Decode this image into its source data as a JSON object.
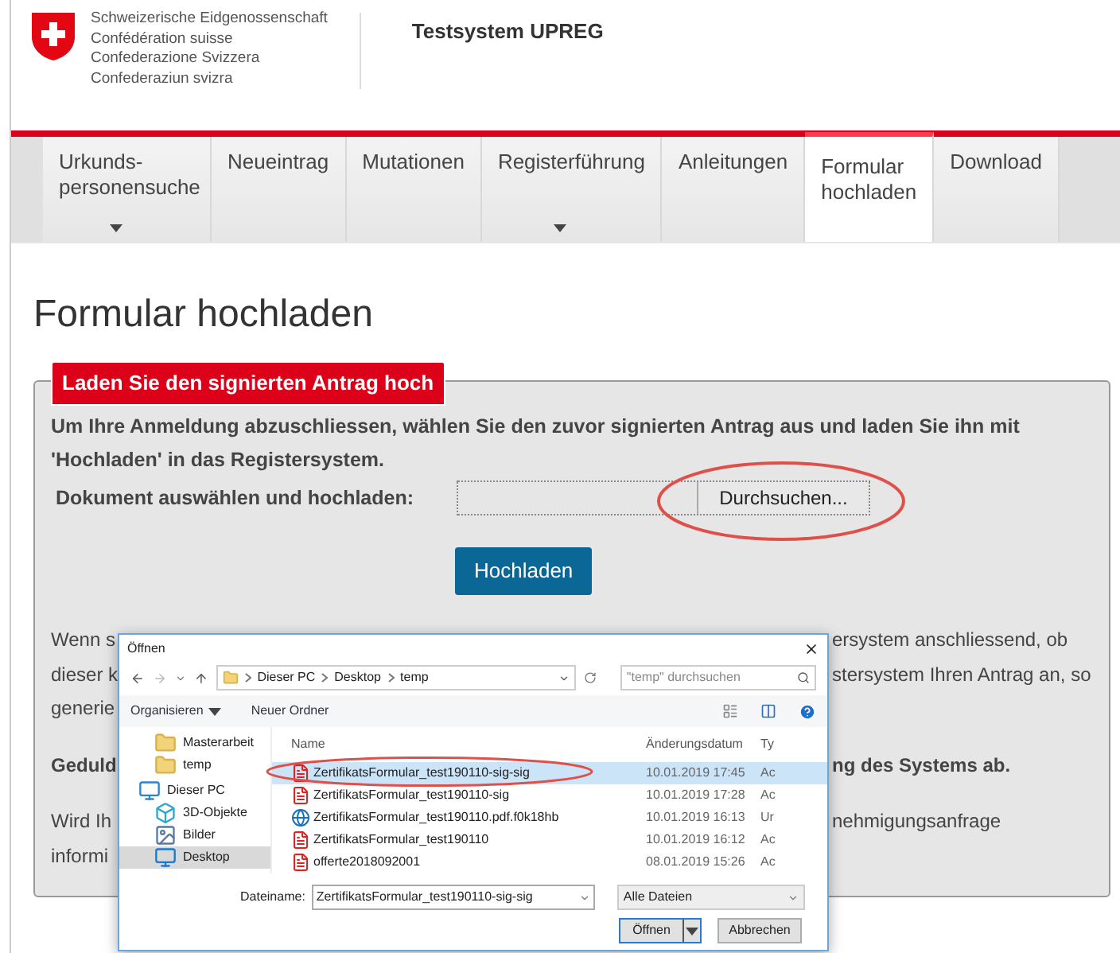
{
  "header": {
    "org_lines": [
      "Schweizerische Eidgenossenschaft",
      "Confédération suisse",
      "Confederazione Svizzera",
      "Confederaziun svizra"
    ],
    "title": "Testsystem UPREG"
  },
  "nav": [
    {
      "lines": [
        "Urkunds-",
        "personensuche"
      ],
      "dropdown": true,
      "selected": false
    },
    {
      "lines": [
        "Neueintrag"
      ],
      "dropdown": false,
      "selected": false
    },
    {
      "lines": [
        "Mutationen"
      ],
      "dropdown": false,
      "selected": false
    },
    {
      "lines": [
        "Registerführung"
      ],
      "dropdown": true,
      "selected": false
    },
    {
      "lines": [
        "Anleitungen"
      ],
      "dropdown": false,
      "selected": false
    },
    {
      "lines": [
        "Formular",
        "hochladen"
      ],
      "dropdown": false,
      "selected": true
    },
    {
      "lines": [
        "Download"
      ],
      "dropdown": false,
      "selected": false
    }
  ],
  "page_title": "Formular hochladen",
  "upload_panel": {
    "legend": "Laden Sie den signierten Antrag hoch",
    "intro": "Um Ihre Anmeldung abzuschliessen, wählen Sie den zuvor signierten Antrag aus und laden Sie ihn mit 'Hochladen' in das Registersystem.",
    "file_label": "Dokument auswählen und hochladen:",
    "browse_button": "Durchsuchen...",
    "upload_button": "Hochladen",
    "paragraphs": [
      {
        "bold": false,
        "lines": [
          {
            "left": "Wenn s",
            "right": "ersystem anschliessend, ob"
          },
          {
            "left": "dieser k",
            "right": "stersystem Ihren Antrag an, so"
          },
          {
            "left": "generie"
          }
        ]
      },
      {
        "bold": true,
        "lines": [
          {
            "left": "Geduld",
            "right": "ng des Systems ab."
          }
        ]
      },
      {
        "bold": false,
        "lines": [
          {
            "left": "Wird Ih",
            "right": "nehmigungsanfrage"
          },
          {
            "left": "informi"
          }
        ]
      }
    ]
  },
  "file_dialog": {
    "title": "Öffnen",
    "path": [
      "Dieser PC",
      "Desktop",
      "temp"
    ],
    "search": {
      "placeholder": "\"temp\" durchsuchen"
    },
    "toolbar": [
      "Organisieren",
      "Neuer Ordner"
    ],
    "nav_items": [
      {
        "label": "Masterarbeit",
        "kind": "folder",
        "selected": false
      },
      {
        "label": "temp",
        "kind": "folder",
        "selected": false
      },
      {
        "label": "Dieser PC",
        "kind": "pc",
        "selected": false
      },
      {
        "label": "3D-Objekte",
        "kind": "cube",
        "selected": false
      },
      {
        "label": "Bilder",
        "kind": "image",
        "selected": false
      },
      {
        "label": "Desktop",
        "kind": "desktop",
        "selected": true
      }
    ],
    "columns": [
      "Name",
      "Änderungsdatum",
      "Ty"
    ],
    "files": [
      {
        "name": "ZertifikatsFormular_test190110-sig-sig",
        "date": "10.01.2019 17:45",
        "type": "Ac",
        "kind": "pdf",
        "selected": true
      },
      {
        "name": "ZertifikatsFormular_test190110-sig",
        "date": "10.01.2019 17:28",
        "type": "Ac",
        "kind": "pdf",
        "selected": false
      },
      {
        "name": "ZertifikatsFormular_test190110.pdf.f0k18hb",
        "date": "10.01.2019 16:13",
        "type": "Ur",
        "kind": "web",
        "selected": false
      },
      {
        "name": "ZertifikatsFormular_test190110",
        "date": "10.01.2019 16:12",
        "type": "Ac",
        "kind": "pdf",
        "selected": false
      },
      {
        "name": "offerte2018092001",
        "date": "08.01.2019 15:26",
        "type": "Ac",
        "kind": "pdf",
        "selected": false
      }
    ],
    "filename_label": "Dateiname:",
    "filename": "ZertifikatsFormular_test190110-sig-sig",
    "filter": "Alle Dateien",
    "open_button": "Öffnen",
    "cancel_button": "Abbrechen"
  }
}
